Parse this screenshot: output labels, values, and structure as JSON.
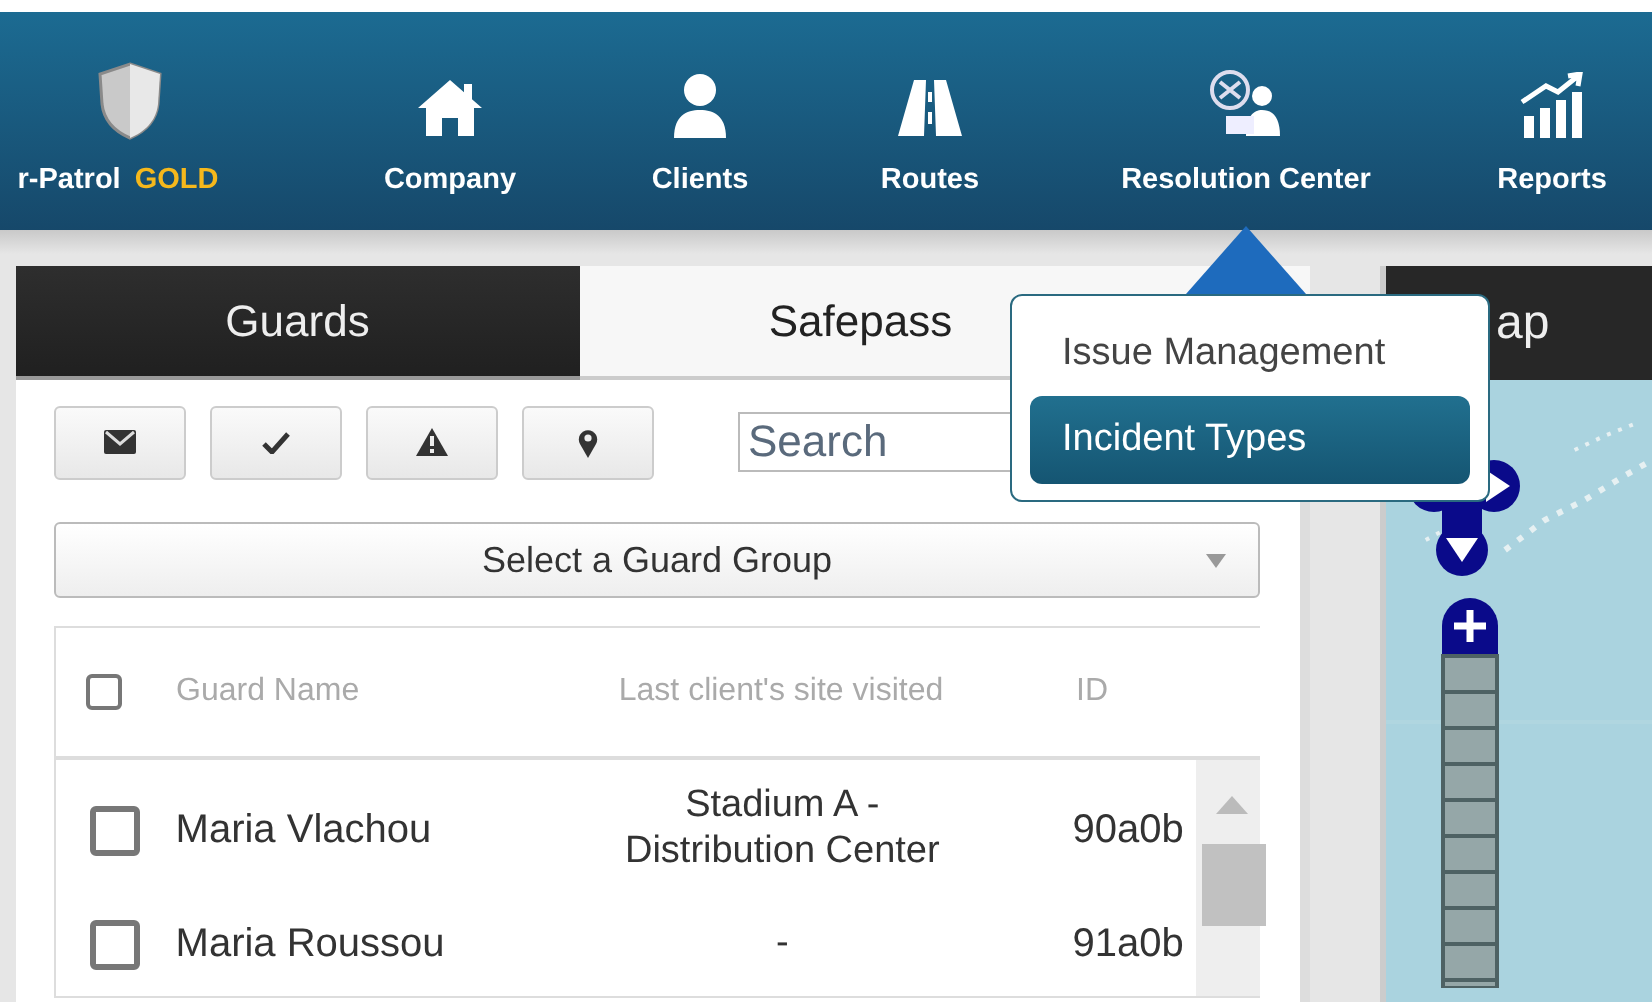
{
  "nav": {
    "brand": {
      "name": "r-Patrol",
      "tier": "GOLD"
    },
    "items": [
      {
        "label": "Company",
        "selected": false
      },
      {
        "label": "Clients",
        "selected": false
      },
      {
        "label": "Routes",
        "selected": false
      },
      {
        "label": "Resolution Center",
        "selected": true
      },
      {
        "label": "Reports",
        "selected": false
      }
    ]
  },
  "menu": {
    "items": [
      {
        "label": "Issue Management",
        "selected": false
      },
      {
        "label": "Incident Types",
        "selected": true
      }
    ]
  },
  "tabs": [
    {
      "label": "Guards",
      "selected": true
    },
    {
      "label": "Safepass",
      "selected": false
    }
  ],
  "search": {
    "placeholder": "Search"
  },
  "group_select": {
    "value": "Select a Guard Group"
  },
  "table": {
    "header_checked": false,
    "columns": [
      "Guard Name",
      "Last client's site visited",
      "ID"
    ],
    "rows": [
      {
        "checked": false,
        "name": "Maria Vlachou",
        "site": "Stadium A - Distribution Center",
        "id": "90a0b"
      },
      {
        "checked": false,
        "name": "Maria Roussou",
        "site": "-",
        "id": "91a0b"
      }
    ]
  },
  "map": {
    "title": "ap"
  }
}
